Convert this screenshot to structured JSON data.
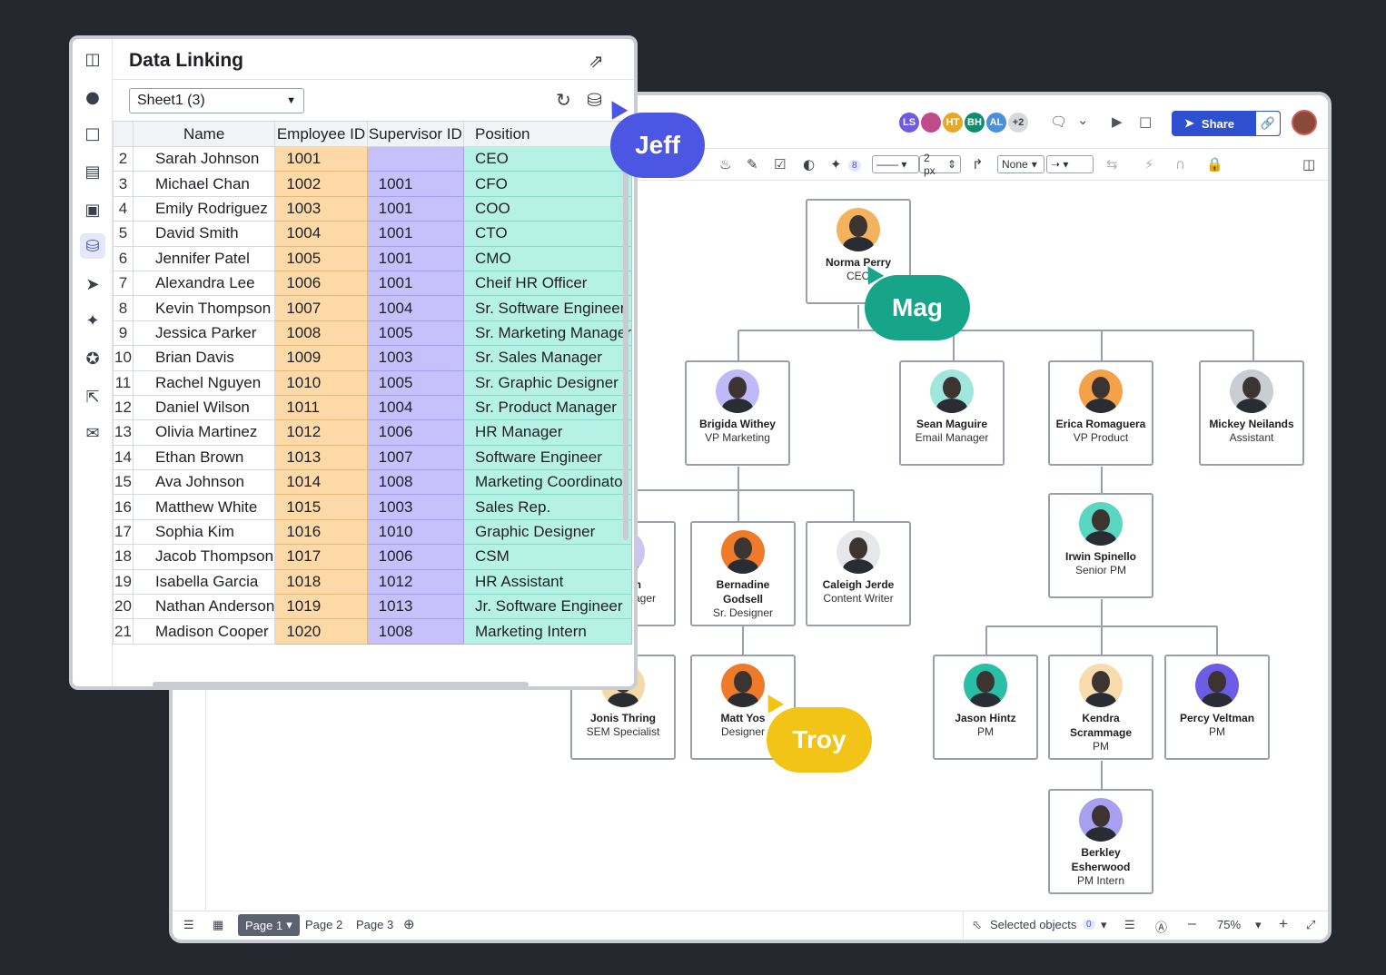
{
  "topbar": {
    "collaborators": [
      {
        "initials": "LS",
        "color": "#6f5ae0"
      },
      {
        "initials": "",
        "color": "#c04a8a"
      },
      {
        "initials": "HT",
        "color": "#e6a82a"
      },
      {
        "initials": "BH",
        "color": "#128c6e"
      },
      {
        "initials": "AL",
        "color": "#4a8fd8"
      },
      {
        "initials": "+2",
        "color": "#d7d9de"
      }
    ],
    "share_label": "Share"
  },
  "toolbar": {
    "badge": "8",
    "line_size": "2 px",
    "line_start": "None"
  },
  "bottombar": {
    "pages": [
      "Page 1",
      "Page 2",
      "Page 3"
    ],
    "selected_label": "Selected objects",
    "selected_count": "0",
    "zoom": "75%"
  },
  "org_chart": {
    "cards": [
      {
        "id": "norma",
        "name": "Norma Perry",
        "role": "CEO",
        "photo_bg": "#f3b25e"
      },
      {
        "id": "brigida",
        "name": "Brigida Withey",
        "role": "VP Marketing",
        "photo_bg": "#bfbaf7"
      },
      {
        "id": "sean",
        "name": "Sean Maguire",
        "role": "Email Manager",
        "photo_bg": "#9fe7dd"
      },
      {
        "id": "erica",
        "name": "Erica Romaguera",
        "role": "VP Product",
        "photo_bg": "#f4a24a"
      },
      {
        "id": "mickey",
        "name": "Mickey Neilands",
        "role": "Assistant",
        "photo_bg": "#c9ccd3"
      },
      {
        "id": "hidden1",
        "name": "n",
        "role": "ager",
        "photo_bg": "#c9c5f6"
      },
      {
        "id": "bernadine",
        "name": "Bernadine Godsell",
        "role": "Sr. Designer",
        "photo_bg": "#ee7a2a"
      },
      {
        "id": "caleigh",
        "name": "Caleigh Jerde",
        "role": "Content Writer",
        "photo_bg": "#e6e7ea"
      },
      {
        "id": "irwin",
        "name": "Irwin Spinello",
        "role": "Senior PM",
        "photo_bg": "#59d7c2"
      },
      {
        "id": "jonis",
        "name": "Jonis Thring",
        "role": "SEM Specialist",
        "photo_bg": "#f6d9a8"
      },
      {
        "id": "matt",
        "name": "Matt Yos",
        "role": "Designer",
        "photo_bg": "#ee7a2a"
      },
      {
        "id": "jason",
        "name": "Jason Hintz",
        "role": "PM",
        "photo_bg": "#29bfa6"
      },
      {
        "id": "kendra",
        "name": "Kendra Scrammage",
        "role": "PM",
        "photo_bg": "#f8dcae"
      },
      {
        "id": "percy",
        "name": "Percy Veltman",
        "role": "PM",
        "photo_bg": "#6d5ce6"
      },
      {
        "id": "berkley",
        "name": "Berkley Esherwood",
        "role": "PM Intern",
        "photo_bg": "#a99ff1"
      }
    ],
    "cursors": [
      {
        "label": "Jeff",
        "color": "#4b56e3"
      },
      {
        "label": "Mag",
        "color": "#17a58a"
      },
      {
        "label": "Troy",
        "color": "#f2c418"
      }
    ]
  },
  "data_linking": {
    "title": "Data Linking",
    "sheet": "Sheet1 (3)",
    "columns": [
      "Name",
      "Employee ID",
      "Supervisor ID",
      "Position"
    ],
    "rows": [
      {
        "n": "2",
        "name": "Sarah Johnson",
        "emp": "1001",
        "sup": "",
        "pos": "CEO"
      },
      {
        "n": "3",
        "name": "Michael Chan",
        "emp": "1002",
        "sup": "1001",
        "pos": "CFO"
      },
      {
        "n": "4",
        "name": "Emily Rodriguez",
        "emp": "1003",
        "sup": "1001",
        "pos": "COO"
      },
      {
        "n": "5",
        "name": "David Smith",
        "emp": "1004",
        "sup": "1001",
        "pos": "CTO"
      },
      {
        "n": "6",
        "name": "Jennifer Patel",
        "emp": "1005",
        "sup": "1001",
        "pos": "CMO"
      },
      {
        "n": "7",
        "name": "Alexandra Lee",
        "emp": "1006",
        "sup": "1001",
        "pos": "Cheif HR Officer"
      },
      {
        "n": "8",
        "name": "Kevin Thompson",
        "emp": "1007",
        "sup": "1004",
        "pos": "Sr. Software Engineer"
      },
      {
        "n": "9",
        "name": "Jessica Parker",
        "emp": "1008",
        "sup": "1005",
        "pos": "Sr. Marketing Manager"
      },
      {
        "n": "10",
        "name": "Brian Davis",
        "emp": "1009",
        "sup": "1003",
        "pos": "Sr. Sales Manager"
      },
      {
        "n": "11",
        "name": "Rachel Nguyen",
        "emp": "1010",
        "sup": "1005",
        "pos": "Sr. Graphic Designer"
      },
      {
        "n": "12",
        "name": "Daniel Wilson",
        "emp": "1011",
        "sup": "1004",
        "pos": "Sr. Product Manager"
      },
      {
        "n": "13",
        "name": "Olivia Martinez",
        "emp": "1012",
        "sup": "1006",
        "pos": "HR Manager"
      },
      {
        "n": "14",
        "name": "Ethan Brown",
        "emp": "1013",
        "sup": "1007",
        "pos": "Software Engineer"
      },
      {
        "n": "15",
        "name": "Ava Johnson",
        "emp": "1014",
        "sup": "1008",
        "pos": "Marketing Coordinator"
      },
      {
        "n": "16",
        "name": "Matthew White",
        "emp": "1015",
        "sup": "1003",
        "pos": "Sales Rep."
      },
      {
        "n": "17",
        "name": "Sophia Kim",
        "emp": "1016",
        "sup": "1010",
        "pos": "Graphic Designer"
      },
      {
        "n": "18",
        "name": "Jacob Thompson",
        "emp": "1017",
        "sup": "1006",
        "pos": "CSM"
      },
      {
        "n": "19",
        "name": "Isabella Garcia",
        "emp": "1018",
        "sup": "1012",
        "pos": "HR Assistant"
      },
      {
        "n": "20",
        "name": "Nathan Anderson",
        "emp": "1019",
        "sup": "1013",
        "pos": "Jr. Software Engineer"
      },
      {
        "n": "21",
        "name": "Madison Cooper",
        "emp": "1020",
        "sup": "1008",
        "pos": "Marketing Intern"
      }
    ]
  },
  "colors": {
    "accent": "#2f4fd1",
    "employee_col": "#fcd9a6",
    "supervisor_col": "#c6c1fa",
    "position_col": "#b6f1e6"
  }
}
